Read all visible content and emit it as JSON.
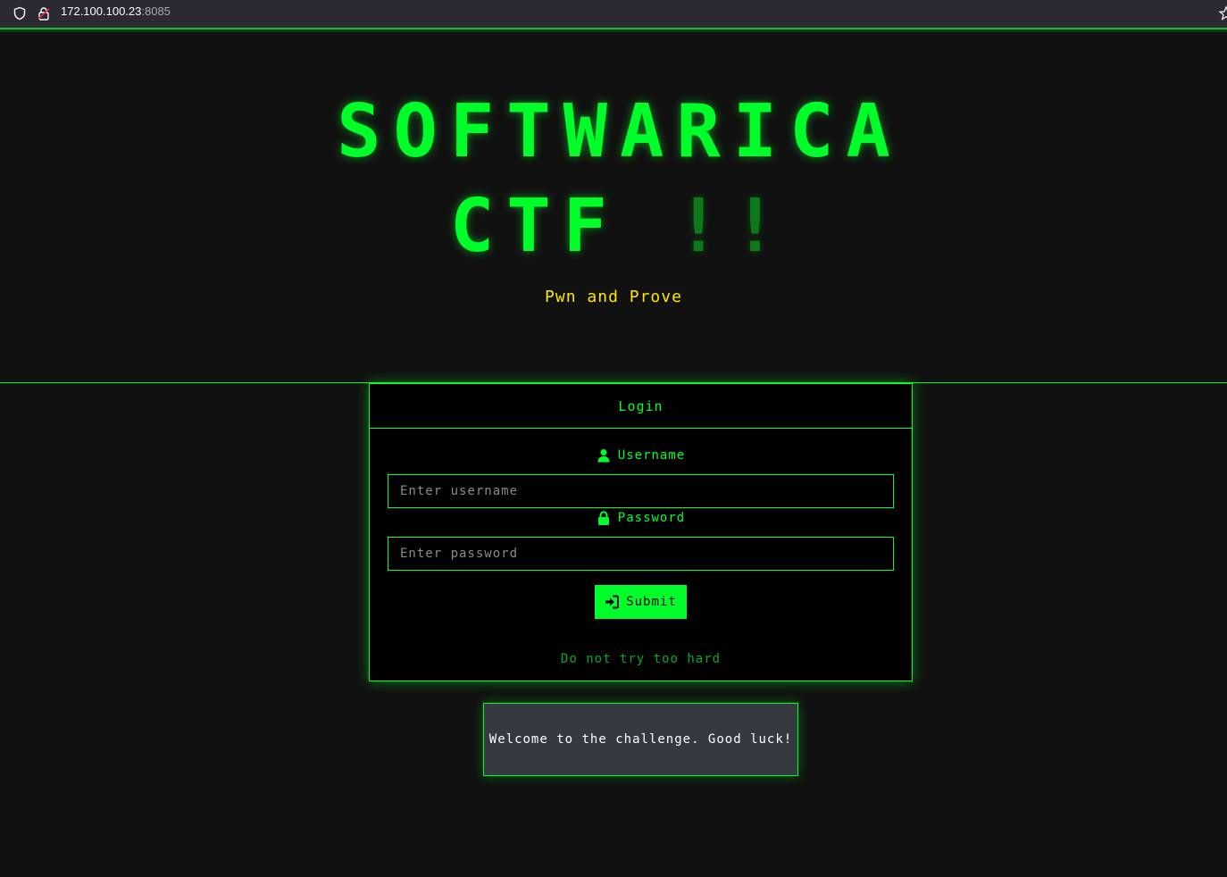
{
  "browser": {
    "url_host": "172.100.100.23",
    "url_port": ":8085"
  },
  "header": {
    "title_line1": "SOFTWARICA",
    "title_line2": "CTF",
    "title_bang": "!!",
    "tagline": "Pwn and Prove"
  },
  "login": {
    "heading": "Login",
    "username_label": "Username",
    "username_placeholder": "Enter username",
    "password_label": "Password",
    "password_placeholder": "Enter password",
    "submit_label": "Submit",
    "hint": "Do not try too hard"
  },
  "message": {
    "text": "Welcome to the challenge. Good luck!"
  },
  "colors": {
    "accent": "#00ff2a",
    "tagline": "#ffe600",
    "background": "#111111"
  },
  "icons": {
    "shield": "shield-icon",
    "lock_url": "lock-icon",
    "user": "user-icon",
    "password": "lock-icon",
    "submit": "sign-in-icon"
  }
}
